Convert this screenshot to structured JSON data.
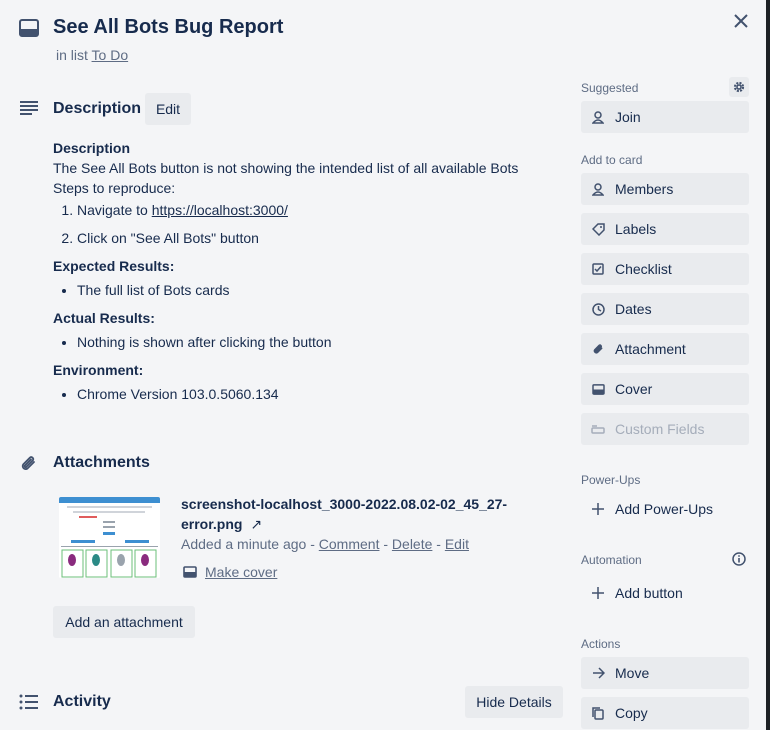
{
  "card": {
    "title": "See All Bots Bug Report",
    "in_list_prefix": "in list",
    "list_name": "To Do"
  },
  "description": {
    "heading": "Description",
    "edit_label": "Edit",
    "body_heading": "Description",
    "summary": "The See All Bots button is not showing the intended list of all available Bots",
    "steps_heading": "Steps to reproduce:",
    "step1_prefix": "Navigate to ",
    "step1_link": "https://localhost:3000/",
    "step2": "Click on \"See All Bots\" button",
    "expected_heading": "Expected Results:",
    "expected_item": "The full list of Bots cards",
    "actual_heading": "Actual Results:",
    "actual_item": "Nothing is shown after clicking the button",
    "environment_heading": "Environment:",
    "environment_item": "Chrome Version 103.0.5060.134"
  },
  "attachments": {
    "heading": "Attachments",
    "file_name": "screenshot-localhost_3000-2022.08.02-02_45_27-error.png",
    "link_arrow": "↗",
    "added": "Added a minute ago",
    "sep": " - ",
    "comment": "Comment",
    "delete": "Delete",
    "edit": "Edit",
    "make_cover": "Make cover",
    "add_label": "Add an attachment"
  },
  "activity": {
    "heading": "Activity",
    "hide_details": "Hide Details"
  },
  "sidebar": {
    "suggested": "Suggested",
    "join": "Join",
    "add_to_card": "Add to card",
    "members": "Members",
    "labels": "Labels",
    "checklist": "Checklist",
    "dates": "Dates",
    "attachment": "Attachment",
    "cover": "Cover",
    "custom_fields": "Custom Fields",
    "power_ups": "Power-Ups",
    "add_power_ups": "Add Power-Ups",
    "automation": "Automation",
    "add_button": "Add button",
    "actions": "Actions",
    "move": "Move",
    "copy": "Copy"
  },
  "colors": {
    "background": "#f4f5f7",
    "button": "#e9ebee",
    "text": "#172b4d",
    "muted": "#5e6c84",
    "disabled": "#a5adba"
  }
}
